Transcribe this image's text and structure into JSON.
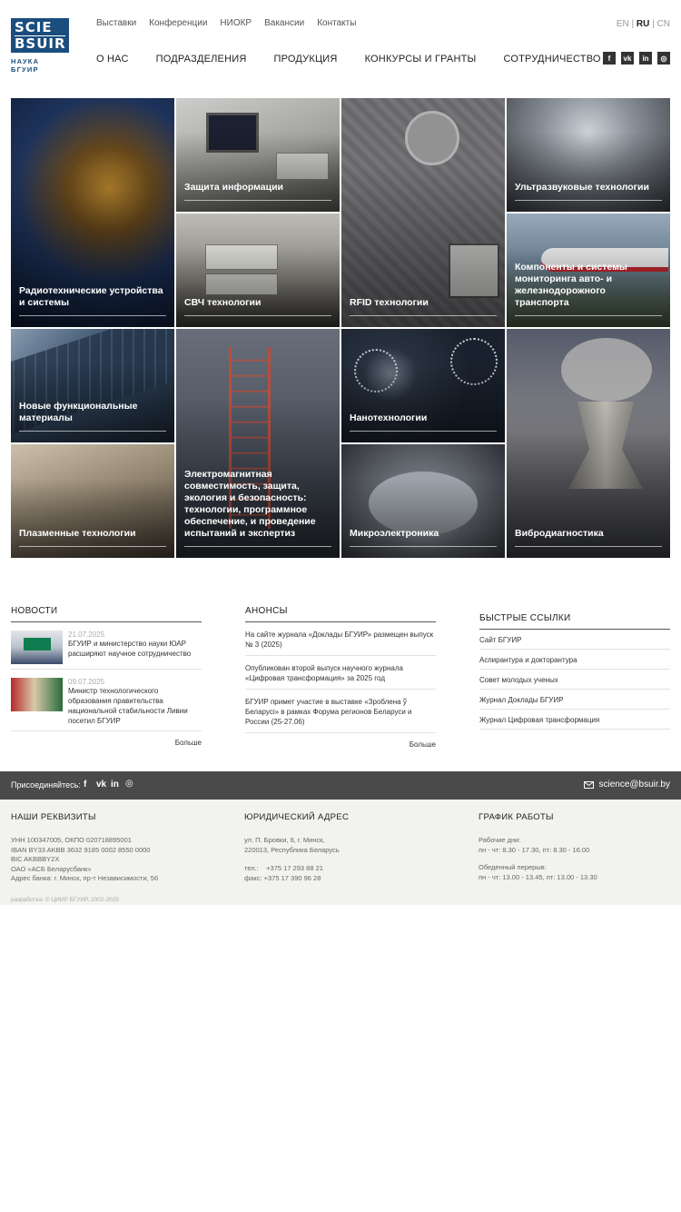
{
  "logo": {
    "line1": "SCIE",
    "line2": "BSUIR",
    "subtitle": "НАУКА БГУИР"
  },
  "topnav": [
    "Выставки",
    "Конференции",
    "НИОКР",
    "Вакансии",
    "Контакты"
  ],
  "lang": {
    "en": "EN",
    "ru": "RU",
    "cn": "CN",
    "sep": "|"
  },
  "mainnav": [
    "О НАС",
    "ПОДРАЗДЕЛЕНИЯ",
    "ПРОДУКЦИЯ",
    "КОНКУРСЫ И ГРАНТЫ",
    "СОТРУДНИЧЕСТВО"
  ],
  "social": [
    "facebook-icon",
    "vk-icon",
    "linkedin-icon",
    "instagram-icon"
  ],
  "social_glyphs": [
    "f",
    "vk",
    "in",
    "◎"
  ],
  "tiles": [
    "Радиотехнические устройства и системы",
    "Защита информации",
    "СВЧ технологии",
    "RFID технологии",
    "Ультразвуковые технологии",
    "Компоненты и системы мониторинга авто- и железнодорожного транспорта",
    "Новые функциональные материалы",
    "Электромагнитная совместимость, защита, экология и безопасность: технологии, программное обеспечение, и проведение испытаний и экспертиз",
    "Нанотехнологии",
    "Вибродиагностика",
    "Плазменные технологии",
    "Микроэлектроника"
  ],
  "news": {
    "title": "НОВОСТИ",
    "items": [
      {
        "date": "21.07.2025",
        "text": "БГУИР и министерство науки ЮАР расширяют научное сотрудничество"
      },
      {
        "date": "09.07.2025",
        "text": "Министр технологического образования правительства национальной стабильности Ливии посетил БГУИР"
      }
    ],
    "more": "Больше"
  },
  "announces": {
    "title": "АНОНСЫ",
    "items": [
      "На сайте журнала «Доклады БГУИР» размещен выпуск № 3 (2025)",
      "Опубликован второй выпуск научного журнала «Цифровая трансформация» за 2025 год",
      "БГУИР примет участие в выставке «Зробле­на ў Беларусі» в рамках Форума регионов Беларуси и России (25-27.06)"
    ],
    "more": "Больше"
  },
  "quicklinks": {
    "title": "БЫСТРЫЕ ССЫЛКИ",
    "items": [
      "Сайт БГУИР",
      "Аспирантура и докторантура",
      "Совет молодых ученых",
      "Журнал Доклады БГУИР",
      "Журнал Цифровая трансформация"
    ]
  },
  "join": {
    "label": "Присоединяйтесь:",
    "email": "science@bsuir.by"
  },
  "footer": {
    "requisites": {
      "title": "НАШИ РЕКВИЗИТЫ",
      "lines": [
        "УНН 100347005, ОКПО 020718895001",
        "IBAN BY33 AKBB 3632 9185 0002 8550 0000",
        "BIC AKBBBY2X",
        "ОАО «АСБ Беларусбанк»",
        "Адрес банка: г. Минск, пр-т Независимости, 56"
      ]
    },
    "address": {
      "title": "ЮРИДИЧЕСКИЙ АДРЕС",
      "lines": [
        "ул. П. Бровки, 6, г. Минск,",
        "220013, Республика Беларусь"
      ],
      "phone": "тел.:    +375 17 293 88 21",
      "fax": "факс: +375 17 390 96 28"
    },
    "schedule": {
      "title": "ГРАФИК РАБОТЫ",
      "work_label": "Рабочие дни:",
      "work": "пн - чт: 8.30 - 17.30, пт: 8.30 - 16.00",
      "lunch_label": "Обеденный перерыв:",
      "lunch": "пн - чт: 13.00 - 13.45, пт: 13.00 - 13.30"
    },
    "credit": "разработка: © ЦИИР БГУИР, 2002-2025"
  }
}
